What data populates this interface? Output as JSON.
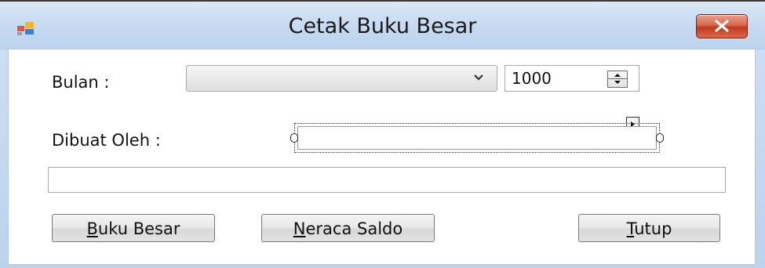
{
  "window": {
    "title": "Cetak Buku Besar"
  },
  "form": {
    "bulan_label": "Bulan :",
    "bulan_value": "",
    "year_value": "1000",
    "dibuat_label": "Dibuat Oleh :",
    "dibuat_value": "",
    "status_value": ""
  },
  "buttons": {
    "buku_besar": {
      "accel": "B",
      "rest": "uku Besar"
    },
    "neraca_saldo": {
      "accel": "N",
      "rest": "eraca Saldo"
    },
    "tutup": {
      "accel": "T",
      "rest": "utup"
    }
  },
  "colors": {
    "titlebar": "#c6daf1",
    "close_button": "#c2391c"
  },
  "icons": {
    "app": "app-form-icon",
    "close": "close-icon",
    "dropdown": "chevron-down-icon",
    "spinner": "spin-updown-icon",
    "smart_tag": "smart-tag-icon"
  }
}
